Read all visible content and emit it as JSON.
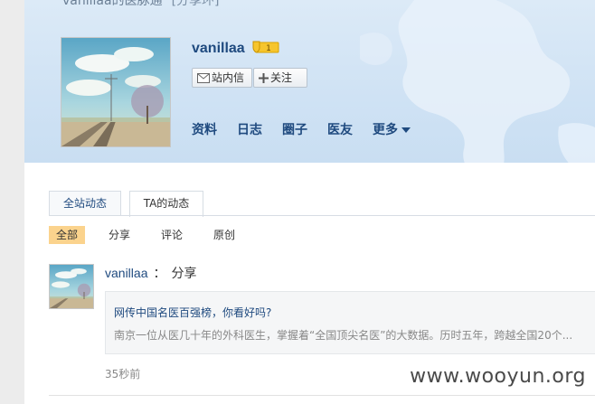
{
  "header": {
    "top_title": "vanillaa的医脉通",
    "top_share": "[分享环]",
    "username": "vanillaa",
    "level": "1",
    "message_button": "站内信",
    "follow_button": "关注",
    "nav": [
      "资料",
      "日志",
      "圈子",
      "医友",
      "更多"
    ]
  },
  "tabs": {
    "all": "全站动态",
    "ta": "TA的动态"
  },
  "filters": [
    "全部",
    "分享",
    "评论",
    "原创"
  ],
  "feed": {
    "user": "vanillaa",
    "colon": "：",
    "action": "分享",
    "title": "网传中国名医百强榜，你看好吗?",
    "desc": "南京一位从医几十年的外科医生，掌握着“全国顶尖名医”的大数据。历时五年，跨越全国20个...",
    "time": "35秒前"
  },
  "watermark": "www.wooyun.org",
  "colors": {
    "link": "#1f4a7f",
    "active_filter": "#fbd38d",
    "banner": "#cfe2f4"
  }
}
